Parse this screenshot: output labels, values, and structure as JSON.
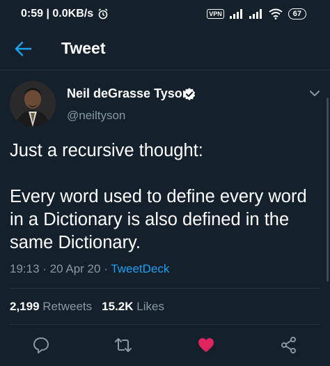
{
  "status_bar": {
    "time_speed": "0:59 | 0.0KB/s",
    "vpn": "VPN",
    "battery": "67"
  },
  "header": {
    "title": "Tweet"
  },
  "tweet": {
    "author_name": "Neil deGrasse Tyson",
    "author_handle": "@neiltyson",
    "text": "Just a recursive thought:\n\nEvery word used to define every word in a Dictionary is also defined in the same Dictionary.",
    "time": "19:13",
    "separator": "·",
    "date": "20 Apr 20",
    "source": "TweetDeck"
  },
  "stats": {
    "retweets_count": "2,199",
    "retweets_label": "Retweets",
    "likes_count": "15.2K",
    "likes_label": "Likes"
  },
  "colors": {
    "background": "#14202b",
    "accent": "#1da1f2",
    "muted": "#8899a6",
    "like": "#e0245e"
  },
  "icons": {
    "back": "arrow-left",
    "verified": "verified-badge",
    "more": "chevron-down",
    "reply": "speech-bubble",
    "retweet": "retweet-arrows",
    "like": "heart-filled",
    "share": "share-nodes"
  }
}
